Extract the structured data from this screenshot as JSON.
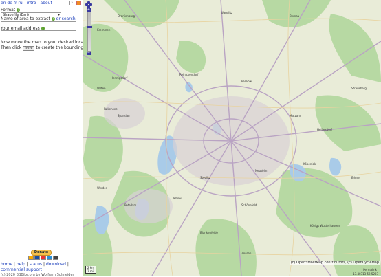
{
  "langbar": {
    "langs": [
      "en",
      "de",
      "fr",
      "ru"
    ],
    "links": [
      "intro",
      "about"
    ],
    "sep": "-"
  },
  "form": {
    "format_label": "Format",
    "format_value": "Shapefile (Esri)",
    "area_label": "Name of area to extract",
    "area_link": "or search",
    "area_value": "",
    "email_label": "Your email address",
    "email_value": ""
  },
  "instructions": {
    "line1": "Now move the map to your desired location.",
    "line2_pre": "Then click",
    "line2_button": "here",
    "line2_post": "to create the bounding box."
  },
  "donate": {
    "label": "Donate"
  },
  "footer": {
    "links": [
      "home",
      "help",
      "status",
      "download",
      "commercial support"
    ],
    "copyright": "(c) 2020 BBBike.org by Wolfram Schneider"
  },
  "map": {
    "attribution": "(c) OpenStreetMap contributors, (c) OpenCycleMap",
    "scale_top": "2 km",
    "scale_bottom": "2 mi",
    "permalink": "Permalink",
    "coords": "13.40313 52.5203"
  },
  "places": [
    "Oranienburg",
    "Bernau",
    "Kremmen",
    "Wandlitz",
    "Hennigsdorf",
    "Velten",
    "Falkensee",
    "Spandau",
    "Reinickendorf",
    "Pankow",
    "Marzahn",
    "Hellersdorf",
    "Potsdam",
    "Steglitz",
    "Neukölln",
    "Köpenick",
    "Teltow",
    "Schönefeld",
    "Erkner",
    "Strausberg",
    "Werder",
    "Zossen",
    "Königs Wusterhausen",
    "Blankenfelde"
  ]
}
